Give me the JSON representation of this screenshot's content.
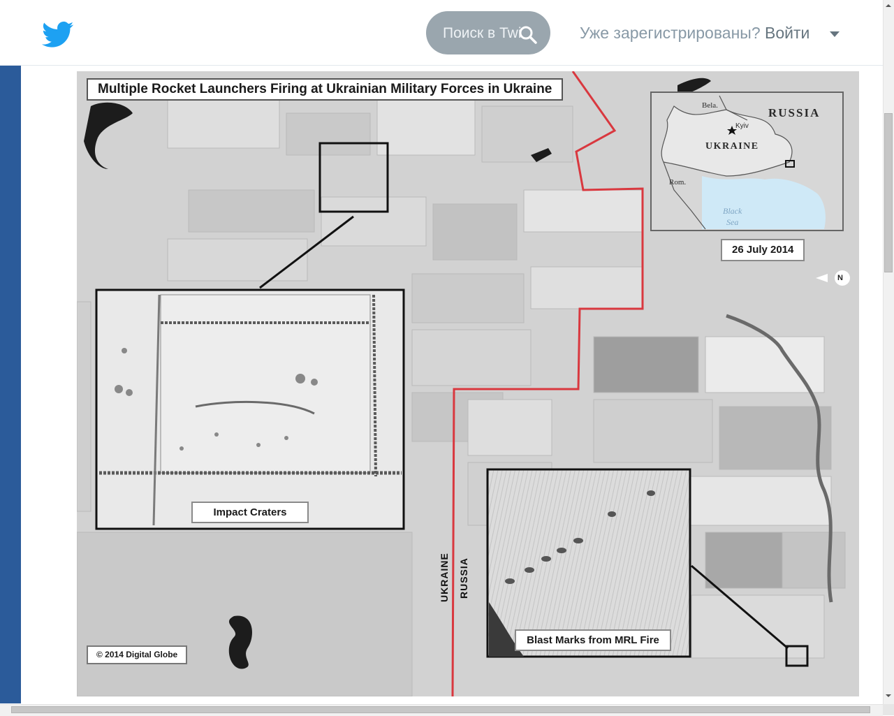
{
  "header": {
    "search_placeholder": "Поиск в Twitter",
    "login_question": "Уже зарегистрированы?",
    "login_link": "Войти",
    "icons": [
      "twitter-bird-icon",
      "search-icon",
      "caret-down-icon"
    ]
  },
  "image": {
    "title": "Multiple Rocket Launchers Firing at Ukrainian Military Forces in Ukraine",
    "date": "26 July 2014",
    "inset_impact_label": "Impact Craters",
    "inset_blast_label": "Blast Marks from MRL Fire",
    "copyright": "© 2014 Digital Globe",
    "border_ukraine": "UKRAINE",
    "border_russia": "RUSSIA",
    "north": "N",
    "locator_map": {
      "russia": "RUSSIA",
      "ukraine": "UKRAINE",
      "bela": "Bela.",
      "rom": "Rom.",
      "kyiv": "Kyiv",
      "black": "Black",
      "sea": "Sea"
    }
  },
  "colors": {
    "twitter_blue": "#1da1f2",
    "search_pill": "#9aa6ae",
    "border_red": "#d9383f",
    "sidebar_blue": "#2b5b9a",
    "sea_blue": "#cfe9f7"
  }
}
